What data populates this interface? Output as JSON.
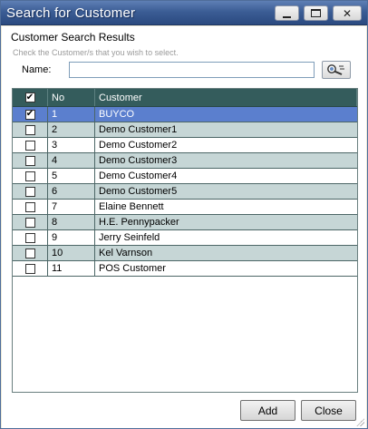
{
  "window": {
    "title": "Search for Customer",
    "controls": {
      "minimize": "minimize-icon",
      "maximize": "maximize-icon",
      "close": "close-icon",
      "close_glyph": "✕"
    }
  },
  "header": {
    "title": "Customer Search Results",
    "instruction": "Check the Customer/s that you wish to select."
  },
  "search": {
    "label": "Name:",
    "value": "",
    "button_icon": "search-icon"
  },
  "grid": {
    "columns": {
      "check": "☑",
      "no": "No",
      "customer": "Customer"
    },
    "header_checked": true,
    "rows": [
      {
        "checked": true,
        "no": "1",
        "customer": "BUYCO",
        "selected": true
      },
      {
        "checked": false,
        "no": "2",
        "customer": "Demo Customer1"
      },
      {
        "checked": false,
        "no": "3",
        "customer": "Demo Customer2"
      },
      {
        "checked": false,
        "no": "4",
        "customer": "Demo Customer3"
      },
      {
        "checked": false,
        "no": "5",
        "customer": "Demo Customer4"
      },
      {
        "checked": false,
        "no": "6",
        "customer": "Demo Customer5"
      },
      {
        "checked": false,
        "no": "7",
        "customer": "Elaine Bennett"
      },
      {
        "checked": false,
        "no": "8",
        "customer": "H.E. Pennypacker"
      },
      {
        "checked": false,
        "no": "9",
        "customer": "Jerry Seinfeld"
      },
      {
        "checked": false,
        "no": "10",
        "customer": "Kel Varnson"
      },
      {
        "checked": false,
        "no": "11",
        "customer": "POS Customer"
      }
    ]
  },
  "buttons": {
    "add": "Add",
    "close": "Close"
  },
  "colors": {
    "title_bar": "#3b5d95",
    "grid_header": "#345c5c",
    "row_alt": "#c6d6d6",
    "row_selected": "#5b7fce"
  }
}
